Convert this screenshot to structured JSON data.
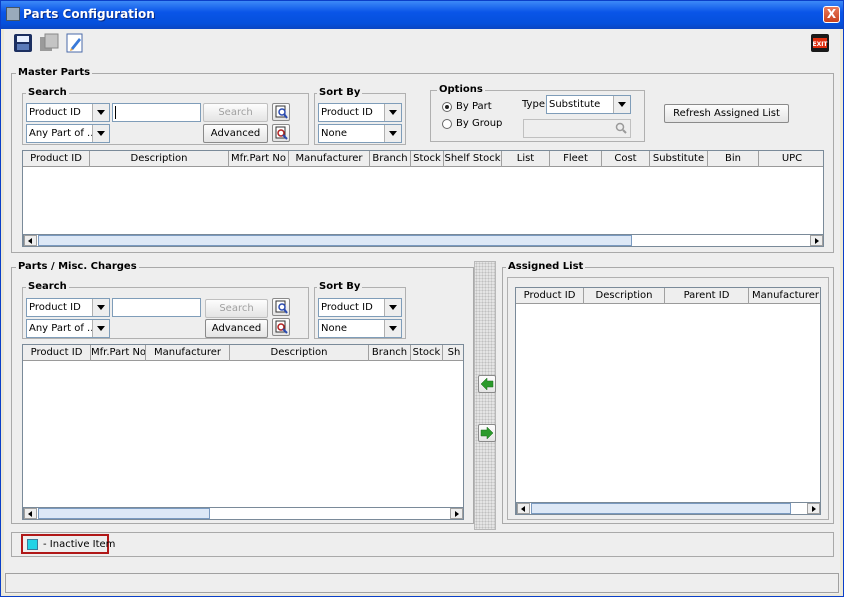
{
  "window": {
    "title": "Parts Configuration",
    "close": "X"
  },
  "toolbar": {
    "exit_label": "EXIT"
  },
  "master": {
    "label": "Master Parts",
    "search": {
      "label": "Search",
      "field": "Product ID",
      "match": "Any Part of ...",
      "value": "",
      "search_button": "Search",
      "advanced_button": "Advanced"
    },
    "sort": {
      "label": "Sort By",
      "primary": "Product ID",
      "secondary": "None"
    },
    "options": {
      "label": "Options",
      "by_part": "By Part",
      "by_group": "By Group",
      "type_label": "Type",
      "type_value": "Substitute"
    },
    "refresh_button": "Refresh Assigned List",
    "columns": [
      "Product ID",
      "Description",
      "Mfr.Part No",
      "Manufacturer",
      "Branch",
      "Stock",
      "Shelf Stock",
      "List",
      "Fleet",
      "Cost",
      "Substitute",
      "Bin",
      "UPC"
    ]
  },
  "misc": {
    "label": "Parts / Misc. Charges",
    "search": {
      "label": "Search",
      "field": "Product ID",
      "match": "Any Part of ...",
      "value": "",
      "search_button": "Search",
      "advanced_button": "Advanced"
    },
    "sort": {
      "label": "Sort By",
      "primary": "Product ID",
      "secondary": "None"
    },
    "columns": [
      "Product ID",
      "Mfr.Part No",
      "Manufacturer",
      "Description",
      "Branch",
      "Stock",
      "Sh"
    ]
  },
  "assigned": {
    "label": "Assigned List",
    "columns": [
      "Product ID",
      "Description",
      "Parent ID",
      "Manufacturer"
    ]
  },
  "legend": {
    "inactive_label": "- Inactive Item",
    "inactive_color": "#22d3e6"
  },
  "colors": {
    "titlebar": "#0a55e8",
    "legend_border": "#b01818"
  }
}
